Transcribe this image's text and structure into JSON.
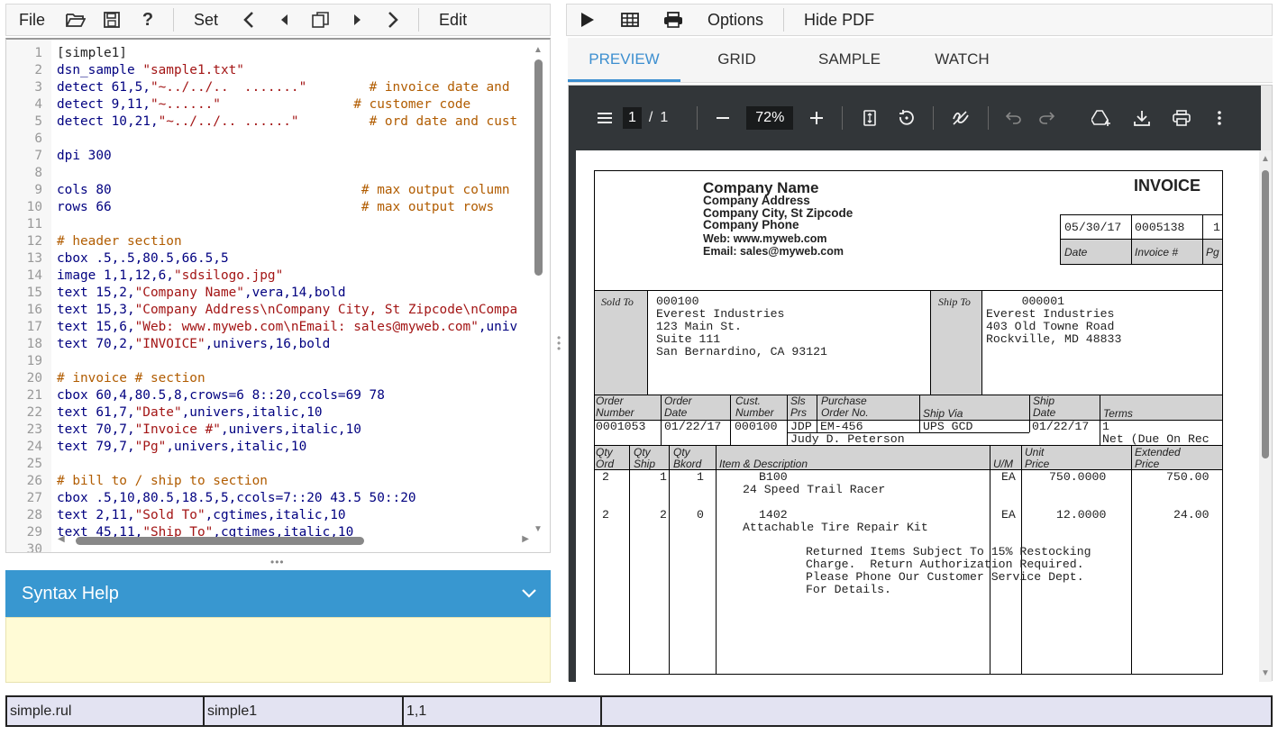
{
  "left_toolbar": {
    "file": "File",
    "set": "Set",
    "edit": "Edit"
  },
  "editor": {
    "lines": [
      {
        "n": "1",
        "parts": [
          [
            "t",
            "[simple1]"
          ]
        ]
      },
      {
        "n": "2",
        "parts": [
          [
            "k",
            "dsn_sample "
          ],
          [
            "s",
            "\"sample1.txt\""
          ]
        ]
      },
      {
        "n": "3",
        "parts": [
          [
            "k",
            "detect 61,5,"
          ],
          [
            "s",
            "\"~../../..  .......\""
          ],
          [
            "t",
            "        "
          ],
          [
            "c",
            "# invoice date and"
          ]
        ]
      },
      {
        "n": "4",
        "parts": [
          [
            "k",
            "detect 9,11,"
          ],
          [
            "s",
            "\"~......\""
          ],
          [
            "t",
            "                 "
          ],
          [
            "c",
            "# customer code"
          ]
        ]
      },
      {
        "n": "5",
        "parts": [
          [
            "k",
            "detect 10,21,"
          ],
          [
            "s",
            "\"~../../.. ......\""
          ],
          [
            "t",
            "         "
          ],
          [
            "c",
            "# ord date and cust"
          ]
        ]
      },
      {
        "n": "6",
        "parts": []
      },
      {
        "n": "7",
        "parts": [
          [
            "k",
            "dpi 300"
          ]
        ]
      },
      {
        "n": "8",
        "parts": []
      },
      {
        "n": "9",
        "parts": [
          [
            "k",
            "cols 80"
          ],
          [
            "t",
            "                                "
          ],
          [
            "c",
            "# max output column"
          ]
        ]
      },
      {
        "n": "10",
        "parts": [
          [
            "k",
            "rows 66"
          ],
          [
            "t",
            "                                "
          ],
          [
            "c",
            "# max output rows"
          ]
        ]
      },
      {
        "n": "11",
        "parts": []
      },
      {
        "n": "12",
        "parts": [
          [
            "c",
            "# header section"
          ]
        ]
      },
      {
        "n": "13",
        "parts": [
          [
            "k",
            "cbox .5,.5,80.5,66.5,5"
          ]
        ]
      },
      {
        "n": "14",
        "parts": [
          [
            "k",
            "image 1,1,12,6,"
          ],
          [
            "s",
            "\"sdsilogo.jpg\""
          ]
        ]
      },
      {
        "n": "15",
        "parts": [
          [
            "k",
            "text 15,2,"
          ],
          [
            "s",
            "\"Company Name\""
          ],
          [
            "k",
            ",vera,14,bold"
          ]
        ]
      },
      {
        "n": "16",
        "parts": [
          [
            "k",
            "text 15,3,"
          ],
          [
            "s",
            "\"Company Address\\nCompany City, St Zipcode\\nCompa"
          ]
        ]
      },
      {
        "n": "17",
        "parts": [
          [
            "k",
            "text 15,6,"
          ],
          [
            "s",
            "\"Web: www.myweb.com\\nEmail: sales@myweb.com\""
          ],
          [
            "k",
            ",univ"
          ]
        ]
      },
      {
        "n": "18",
        "parts": [
          [
            "k",
            "text 70,2,"
          ],
          [
            "s",
            "\"INVOICE\""
          ],
          [
            "k",
            ",univers,16,bold"
          ]
        ]
      },
      {
        "n": "19",
        "parts": []
      },
      {
        "n": "20",
        "parts": [
          [
            "c",
            "# invoice # section"
          ]
        ]
      },
      {
        "n": "21",
        "parts": [
          [
            "k",
            "cbox 60,4,80.5,8,crows=6 8::20,ccols=69 78"
          ]
        ]
      },
      {
        "n": "22",
        "parts": [
          [
            "k",
            "text 61,7,"
          ],
          [
            "s",
            "\"Date\""
          ],
          [
            "k",
            ",univers,italic,10"
          ]
        ]
      },
      {
        "n": "23",
        "parts": [
          [
            "k",
            "text 70,7,"
          ],
          [
            "s",
            "\"Invoice #\""
          ],
          [
            "k",
            ",univers,italic,10"
          ]
        ]
      },
      {
        "n": "24",
        "parts": [
          [
            "k",
            "text 79,7,"
          ],
          [
            "s",
            "\"Pg\""
          ],
          [
            "k",
            ",univers,italic,10"
          ]
        ]
      },
      {
        "n": "25",
        "parts": []
      },
      {
        "n": "26",
        "parts": [
          [
            "c",
            "# bill to / ship to section"
          ]
        ]
      },
      {
        "n": "27",
        "parts": [
          [
            "k",
            "cbox .5,10,80.5,18.5,5,ccols=7::20 43.5 50::20"
          ]
        ]
      },
      {
        "n": "28",
        "parts": [
          [
            "k",
            "text 2,11,"
          ],
          [
            "s",
            "\"Sold To\""
          ],
          [
            "k",
            ",cgtimes,italic,10"
          ]
        ]
      },
      {
        "n": "29",
        "parts": [
          [
            "k",
            "text 45,11,"
          ],
          [
            "s",
            "\"Ship To\""
          ],
          [
            "k",
            ",cgtimes,italic,10"
          ]
        ]
      },
      {
        "n": "30",
        "parts": []
      }
    ]
  },
  "syntax_help": {
    "title": "Syntax Help"
  },
  "right_toolbar": {
    "options": "Options",
    "hide_pdf": "Hide PDF"
  },
  "tabs": [
    {
      "label": "PREVIEW",
      "active": true
    },
    {
      "label": "GRID",
      "active": false
    },
    {
      "label": "SAMPLE",
      "active": false
    },
    {
      "label": "WATCH",
      "active": false
    }
  ],
  "pdf_toolbar": {
    "page": "1",
    "page_sep": "/",
    "total_pages": "1",
    "zoom": "72%"
  },
  "invoice": {
    "company_name": "Company Name",
    "company_address": "Company Address",
    "company_city": "Company City, St Zipcode",
    "company_phone": "Company Phone",
    "web": "Web: www.myweb.com",
    "email": "Email: sales@myweb.com",
    "title": "INVOICE",
    "date_value": "05/30/17",
    "invoice_no_value": "0005138",
    "pg_value": "1",
    "date_label": "Date",
    "invoice_no_label": "Invoice #",
    "pg_label": "Pg",
    "sold_to_label": "Sold To",
    "sold_to": "000100\nEverest Industries\n123 Main St.\nSuite 111\nSan Bernardino, CA 93121",
    "ship_to_label": "Ship To",
    "ship_to": "     000001\nEverest Industries\n403 Old Towne Road\nRockville, MD 48833",
    "order_headers": {
      "order_number": "Order\nNumber",
      "order_date": "Order\nDate",
      "cust_number": "Cust.\nNumber",
      "sls_prs": "Sls\nPrs",
      "purchase_order": "Purchase\nOrder No.",
      "ship_via": "Ship Via",
      "ship_date": "Ship\nDate",
      "terms": "Terms"
    },
    "order_values": {
      "order_number": "0001053",
      "order_date": "01/22/17",
      "cust_number": "000100",
      "sls_prs": "JDP",
      "purchase_order": "EM-456",
      "buyer": "Judy D. Peterson",
      "ship_via": "UPS GCD",
      "ship_date": "01/22/17",
      "terms": "1\nNet (Due On Rec"
    },
    "item_headers": {
      "qty_ord": "Qty\nOrd",
      "qty_ship": "Qty\nShip",
      "qty_bkord": "Qty\nBkord",
      "item_desc": "Item & Description",
      "um": "U/M",
      "unit_price": "Unit\nPrice",
      "ext_price": "Extended\nPrice"
    },
    "items": [
      {
        "ord": "2",
        "ship": "1",
        "bkord": "1",
        "code": "B100",
        "desc": "24 Speed Trail Racer",
        "um": "EA",
        "unit": "750.0000",
        "ext": "750.00"
      },
      {
        "ord": "2",
        "ship": "2",
        "bkord": "0",
        "code": "1402",
        "desc": "Attachable Tire Repair Kit",
        "um": "EA",
        "unit": "12.0000",
        "ext": "24.00"
      }
    ],
    "note": "Returned Items Subject To 15% Restocking\nCharge.  Return Authorization Required.\nPlease Phone Our Customer Service Dept.\nFor Details."
  },
  "statusbar": {
    "file": "simple.rul",
    "section": "simple1",
    "position": "1,1",
    "extra": ""
  }
}
